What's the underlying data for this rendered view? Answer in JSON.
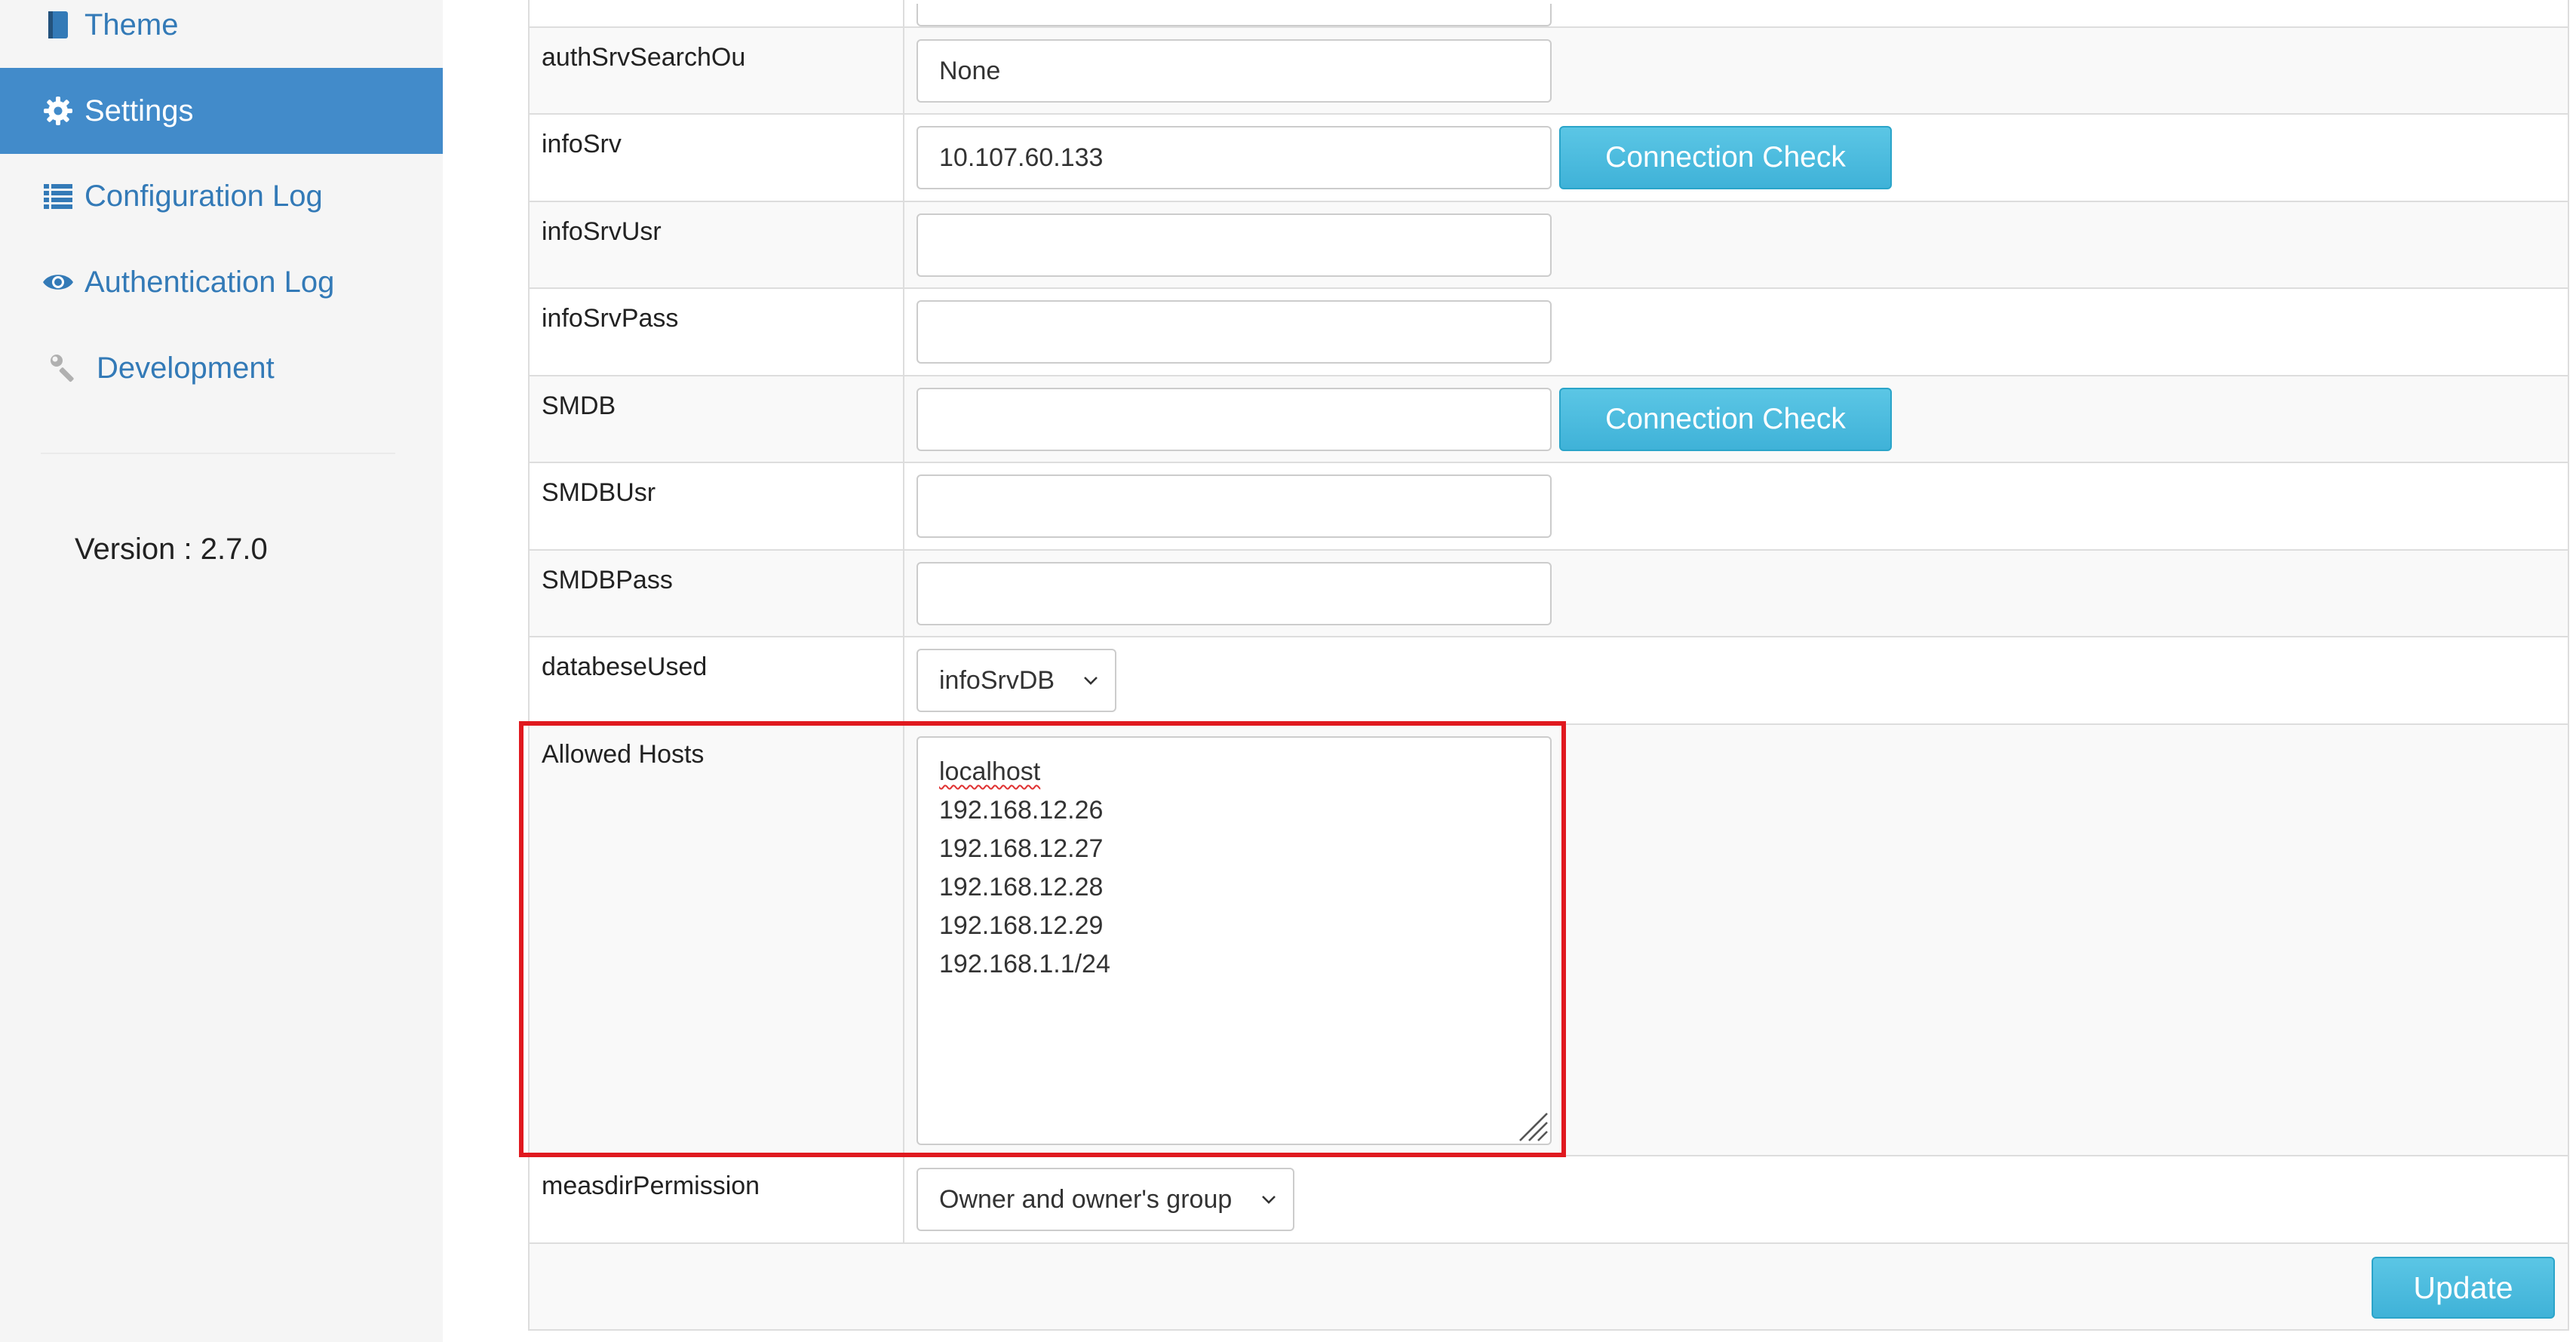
{
  "sidebar": {
    "items": [
      {
        "label": "Theme",
        "icon": "book-icon"
      },
      {
        "label": "Settings",
        "icon": "gear-icon"
      },
      {
        "label": "Configuration Log",
        "icon": "list-icon"
      },
      {
        "label": "Authentication Log",
        "icon": "eye-icon"
      },
      {
        "label": "Development",
        "icon": "wrench-icon"
      }
    ],
    "active_index": 1,
    "version": "Version : 2.7.0"
  },
  "form": {
    "authSrvSearchOu": {
      "label": "authSrvSearchOu",
      "value": "None"
    },
    "infoSrv": {
      "label": "infoSrv",
      "value": "10.107.60.133",
      "button": "Connection Check"
    },
    "infoSrvUsr": {
      "label": "infoSrvUsr",
      "value": ""
    },
    "infoSrvPass": {
      "label": "infoSrvPass",
      "value": ""
    },
    "SMDB": {
      "label": "SMDB",
      "value": "",
      "button": "Connection Check"
    },
    "SMDBUsr": {
      "label": "SMDBUsr",
      "value": ""
    },
    "SMDBPass": {
      "label": "SMDBPass",
      "value": ""
    },
    "databeseUsed": {
      "label": "databeseUsed",
      "selected": "infoSrvDB"
    },
    "allowedHosts": {
      "label": "Allowed Hosts",
      "lines": [
        "localhost",
        "192.168.12.26",
        "192.168.12.27",
        "192.168.12.28",
        "192.168.12.29",
        "192.168.1.1/24"
      ]
    },
    "measdirPermission": {
      "label": "measdirPermission",
      "selected": "Owner and owner's group"
    },
    "update_label": "Update"
  },
  "colors": {
    "sidebar_bg": "#f5f5f5",
    "active_nav": "#428bca",
    "link": "#337ab7",
    "info_button": "#5bc0de",
    "highlight": "#e0191f"
  }
}
